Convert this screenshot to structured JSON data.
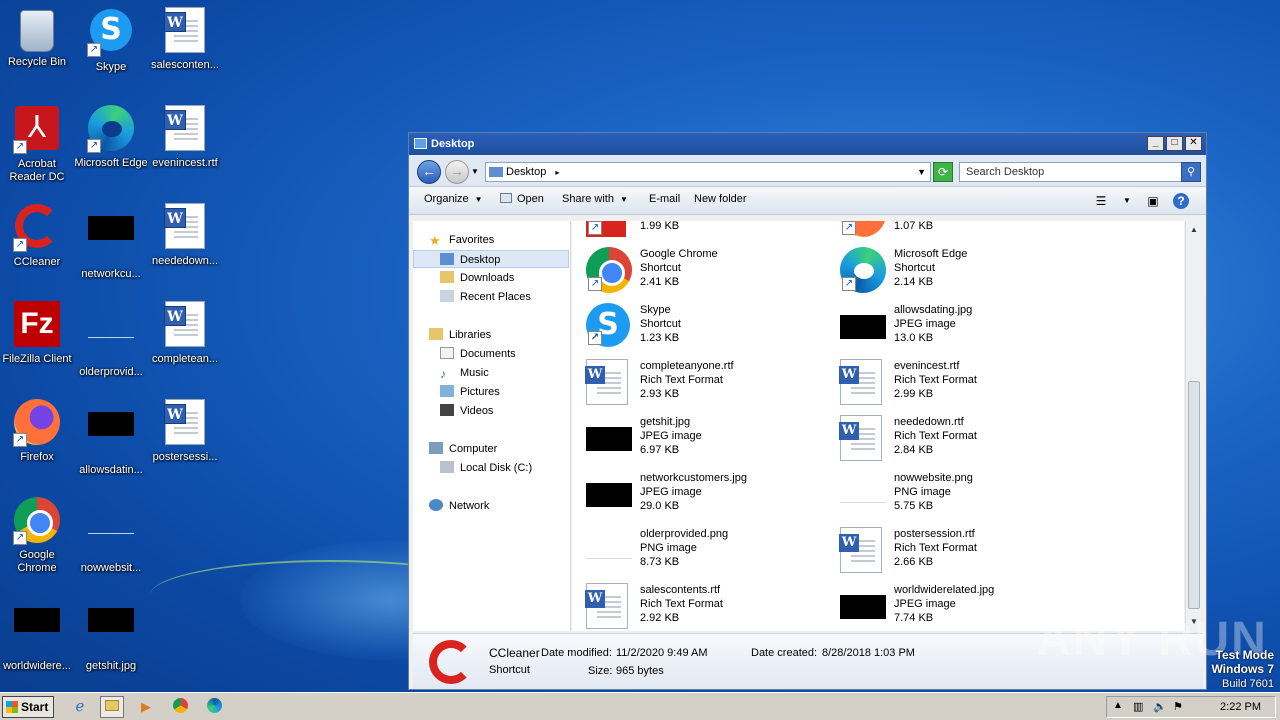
{
  "desktop": {
    "icons": [
      {
        "label": "Recycle Bin"
      },
      {
        "label": "Skype"
      },
      {
        "label": "salesconten..."
      },
      {
        "label": "Acrobat Reader DC"
      },
      {
        "label": "Microsoft Edge"
      },
      {
        "label": "evenincest.rtf"
      },
      {
        "label": "CCleaner"
      },
      {
        "label": "networkcu..."
      },
      {
        "label": "neededown..."
      },
      {
        "label": "FileZilla Client"
      },
      {
        "label": "olderprovid..."
      },
      {
        "label": "completean..."
      },
      {
        "label": "Firefox"
      },
      {
        "label": "allowsdatin..."
      },
      {
        "label": "postersessi..."
      },
      {
        "label": "Google Chrome"
      },
      {
        "label": "nowwebsit..."
      },
      {
        "label": "worldwidere..."
      },
      {
        "label": "getshit.jpg"
      }
    ]
  },
  "window": {
    "title": "Desktop",
    "address": "Desktop",
    "search_placeholder": "Search Desktop",
    "toolbar": {
      "organize": "Organize",
      "open": "Open",
      "share_with": "Share with",
      "email": "E-mail",
      "new_folder": "New folder"
    },
    "nav": {
      "favorites": "Favorites",
      "desktop": "Desktop",
      "downloads": "Downloads",
      "recent_places": "Recent Places",
      "libraries": "Libraries",
      "documents": "Documents",
      "music": "Music",
      "pictures": "Pictures",
      "videos": "Videos",
      "computer": "Computer",
      "local_disk": "Local Disk (C:)",
      "network": "Network"
    },
    "files": {
      "partial_left_size": "1.99 KB",
      "partial_right_size": "1.07 KB",
      "items": [
        {
          "name": "Google Chrome",
          "type": "Shortcut",
          "size": "2.41 KB"
        },
        {
          "name": "Microsoft Edge",
          "type": "Shortcut",
          "size": "2.14 KB"
        },
        {
          "name": "Skype",
          "type": "Shortcut",
          "size": "1.23 KB"
        },
        {
          "name": "allowsdating.jpg",
          "type": "JPEG image",
          "size": "13.0 KB"
        },
        {
          "name": "completeanyone.rtf",
          "type": "Rich Text Format",
          "size": "2.93 KB"
        },
        {
          "name": "evenincest.rtf",
          "type": "Rich Text Format",
          "size": "2.99 KB"
        },
        {
          "name": "getshit.jpg",
          "type": "JPEG image",
          "size": "6.97 KB"
        },
        {
          "name": "neededown.rtf",
          "type": "Rich Text Format",
          "size": "2.84 KB"
        },
        {
          "name": "networkcustomers.jpg",
          "type": "JPEG image",
          "size": "29.0 KB"
        },
        {
          "name": "nowwebsite.png",
          "type": "PNG image",
          "size": "5.75 KB"
        },
        {
          "name": "olderprovided.png",
          "type": "PNG image",
          "size": "8.73 KB"
        },
        {
          "name": "postersession.rtf",
          "type": "Rich Text Format",
          "size": "2.66 KB"
        },
        {
          "name": "salescontents.rtf",
          "type": "Rich Text Format",
          "size": "2.92 KB"
        },
        {
          "name": "worldwiderelated.jpg",
          "type": "JPEG image",
          "size": "7.74 KB"
        }
      ]
    },
    "details": {
      "name": "CCleaner",
      "type": "Shortcut",
      "date_modified_label": "Date modified:",
      "date_modified": "11/2/2020 9:49 AM",
      "date_created_label": "Date created:",
      "date_created": "8/28/2018 1:03 PM",
      "size_label": "Size:",
      "size": "965 bytes"
    }
  },
  "taskbar": {
    "start": "Start",
    "clock": "2:22 PM"
  },
  "watermark": {
    "line1": "Test Mode",
    "line2": "Windows 7",
    "line3": "Build 7601",
    "brand": "ANY RUN"
  }
}
